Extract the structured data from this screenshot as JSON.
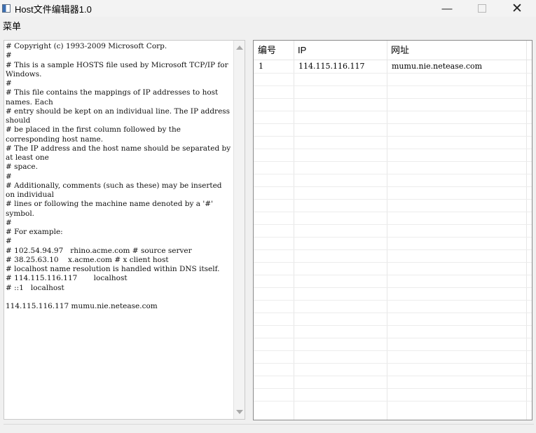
{
  "window": {
    "title": "Host文件编辑器1.0",
    "icon": "app-icon",
    "minimize_label": "—",
    "close_label": "✕"
  },
  "menu": {
    "items": [
      "菜单"
    ]
  },
  "editor": {
    "content": "# Copyright (c) 1993-2009 Microsoft Corp.\n#\n# This is a sample HOSTS file used by Microsoft TCP/IP for Windows.\n#\n# This file contains the mappings of IP addresses to host names. Each\n# entry should be kept on an individual line. The IP address should\n# be placed in the first column followed by the corresponding host name.\n# The IP address and the host name should be separated by at least one\n# space.\n#\n# Additionally, comments (such as these) may be inserted on individual\n# lines or following the machine name denoted by a '#' symbol.\n#\n# For example:\n#\n# 102.54.94.97   rhino.acme.com # source server\n# 38.25.63.10    x.acme.com # x client host\n# localhost name resolution is handled within DNS itself.\n# 114.115.116.117       localhost\n# ::1   localhost\n\n114.115.116.117 mumu.nie.netease.com"
  },
  "table": {
    "columns": [
      "编号",
      "IP",
      "网址"
    ],
    "rows": [
      [
        "1",
        "114.115.116.117",
        "mumu.nie.netease.com"
      ]
    ]
  },
  "colors": {
    "background": "#f0f0f0",
    "panel": "#ffffff",
    "border": "#8a8a8a"
  }
}
